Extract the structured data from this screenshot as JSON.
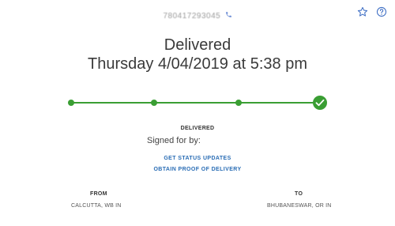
{
  "header": {
    "tracking_number": "780417293045",
    "tracking_icon": "phone-icon",
    "star_icon": "star-outline-icon",
    "help_icon": "help-circle-icon"
  },
  "status": {
    "title": "Delivered",
    "date": "Thursday 4/04/2019 at 5:38 pm",
    "progress_steps_completed": 4,
    "progress_steps_total": 4,
    "accent_color": "#3a9e33"
  },
  "details": {
    "status_label": "DELIVERED",
    "signed_for_by": "Signed for by:"
  },
  "links": {
    "status_updates": "GET STATUS UPDATES",
    "proof_of_delivery": "OBTAIN PROOF OF DELIVERY",
    "color": "#2a6db5"
  },
  "shipment": {
    "from_label": "FROM",
    "from_value": "CALCUTTA, WB IN",
    "to_label": "TO",
    "to_value": "BHUBANESWAR, OR IN"
  }
}
